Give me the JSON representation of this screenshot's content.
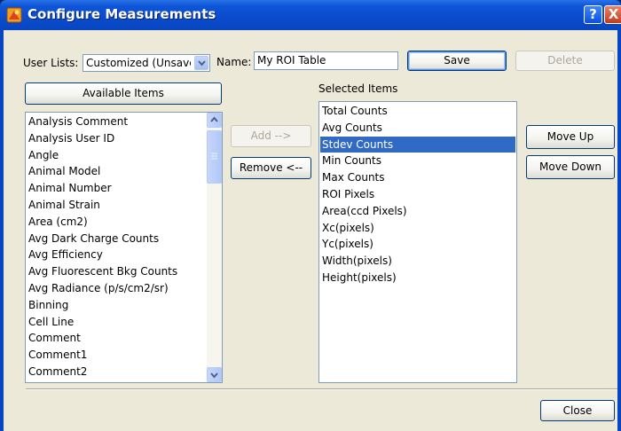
{
  "window": {
    "title": "Configure Measurements",
    "help_glyph": "?",
    "close_glyph": "X"
  },
  "top": {
    "user_lists_label": "User Lists:",
    "user_lists_value": "Customized (Unsaved)",
    "name_label": "Name:",
    "name_value": "My ROI Table",
    "save_label": "Save",
    "delete_label": "Delete"
  },
  "available": {
    "header_button": "Available Items",
    "items": [
      "Analysis Comment",
      "Analysis User ID",
      "Angle",
      "Animal Model",
      "Animal Number",
      "Animal Strain",
      "Area (cm2)",
      "Avg Dark Charge Counts",
      "Avg Efficiency",
      "Avg Fluorescent Bkg Counts",
      "Avg Radiance (p/s/cm2/sr)",
      "Binning",
      "Cell Line",
      "Comment",
      "Comment1",
      "Comment2"
    ]
  },
  "middle": {
    "add_label": "Add  -->",
    "remove_label": "Remove <--"
  },
  "selected": {
    "header": "Selected Items",
    "selected_index": 2,
    "items": [
      "Total Counts",
      "Avg Counts",
      "Stdev Counts",
      "Min Counts",
      "Max Counts",
      "ROI Pixels",
      "Area(ccd Pixels)",
      "Xc(pixels)",
      "Yc(pixels)",
      "Width(pixels)",
      "Height(pixels)"
    ]
  },
  "right": {
    "move_up_label": "Move  Up",
    "move_down_label": "Move Down"
  },
  "footer": {
    "close_label": "Close"
  },
  "colors": {
    "title_bar": "#0a4bcc",
    "selection": "#316ac5",
    "dialog_bg": "#ece9d8"
  }
}
